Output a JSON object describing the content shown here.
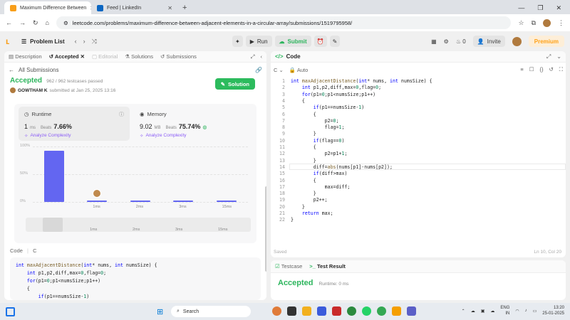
{
  "browser": {
    "tabs": [
      {
        "title": "Maximum Difference Between",
        "active": true,
        "icon_color": "#f89f1b"
      },
      {
        "title": "Feed | LinkedIn",
        "active": false,
        "icon_color": "#0a66c2"
      }
    ],
    "url": "leetcode.com/problems/maximum-difference-between-adjacent-elements-in-a-circular-array/submissions/1519795958/"
  },
  "topbar": {
    "problem_list": "Problem List",
    "run": "Run",
    "submit": "Submit",
    "notifications": "0",
    "invite": "Invite",
    "premium": "Premium"
  },
  "left_tabs": {
    "description": "Description",
    "accepted": "Accepted",
    "editorial": "Editorial",
    "solutions": "Solutions",
    "submissions": "Submissions"
  },
  "submission": {
    "back_label": "All Submissions",
    "status": "Accepted",
    "testcases": "962 / 962 testcases passed",
    "user": "GOWTHAM K",
    "submitted_at": "submitted at Jan 25, 2025 13:16",
    "solution_button": "Solution"
  },
  "runtime": {
    "label": "Runtime",
    "value": "1",
    "unit": "ms",
    "beats_label": "Beats",
    "beats": "7.66%",
    "analyze": "Analyze Complexity"
  },
  "memory": {
    "label": "Memory",
    "value": "9.02",
    "unit": "MB",
    "beats_label": "Beats",
    "beats": "75.74%",
    "analyze": "Analyze Complexity"
  },
  "chart_data": {
    "type": "bar",
    "categories": [
      "0ms",
      "1ms",
      "2ms",
      "3ms",
      "15ms"
    ],
    "values": [
      92,
      2,
      2,
      3,
      2
    ],
    "ytick_labels": [
      "100%",
      "50%",
      "0%"
    ],
    "ylim": [
      0,
      100
    ],
    "xlabel": "",
    "ylabel": "",
    "scrubber_labels": [
      "1ms",
      "2ms",
      "3ms",
      "15ms"
    ],
    "bar_color": "#6366f1"
  },
  "code_section": {
    "label": "Code",
    "lang": "C",
    "preview_lines": [
      "int maxAdjacentDistance(int* nums, int numsSize) {",
      "    int p1,p2,diff,max=0,flag=0;",
      "    for(p1=0;p1<numsSize;p1++)",
      "    {",
      "        if(p1==numsSize-1)"
    ]
  },
  "editor": {
    "title": "Code",
    "lang": "C",
    "mode": "Auto",
    "lines": [
      "int maxAdjacentDistance(int* nums, int numsSize) {",
      "    int p1,p2,diff,max=0,flag=0;",
      "    for(p1=0;p1<numsSize;p1++)",
      "    {",
      "        if(p1==numsSize-1)",
      "        {",
      "            p2=0;",
      "            flag=1;",
      "        }",
      "        if(flag==0)",
      "        {",
      "            p2=p1+1;",
      "        }",
      "        diff=abs(nums[p1]-nums[p2]);",
      "        if(diff>max)",
      "        {",
      "            max=diff;",
      "        }",
      "        p2++;",
      "    }",
      "    return max;",
      "}"
    ],
    "saved": "Saved",
    "position": "Ln 10, Col 20"
  },
  "bottom": {
    "testcase": "Testcase",
    "test_result": "Test Result",
    "status": "Accepted",
    "runtime": "Runtime: 0 ms"
  },
  "taskbar": {
    "search": "Search",
    "lang": "ENG",
    "region": "IN",
    "time": "13:20",
    "date": "25-01-2025"
  }
}
